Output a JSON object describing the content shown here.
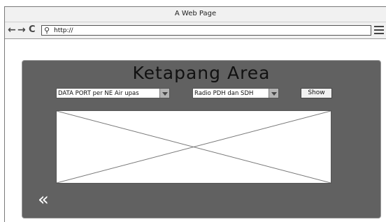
{
  "window": {
    "title": "A Web Page"
  },
  "navbar": {
    "back_icon": "←",
    "forward_icon": "→",
    "reload_icon": "C",
    "search_icon": "⚲",
    "url": "http://"
  },
  "panel": {
    "title": "Ketapang Area",
    "select_port": "DATA PORT per NE Air upas",
    "select_radio": "Radio PDH dan SDH",
    "show_label": "Show",
    "back_symbol": "«"
  },
  "colors": {
    "panel_background": "#616161",
    "chrome_background": "#f1f1f1"
  }
}
